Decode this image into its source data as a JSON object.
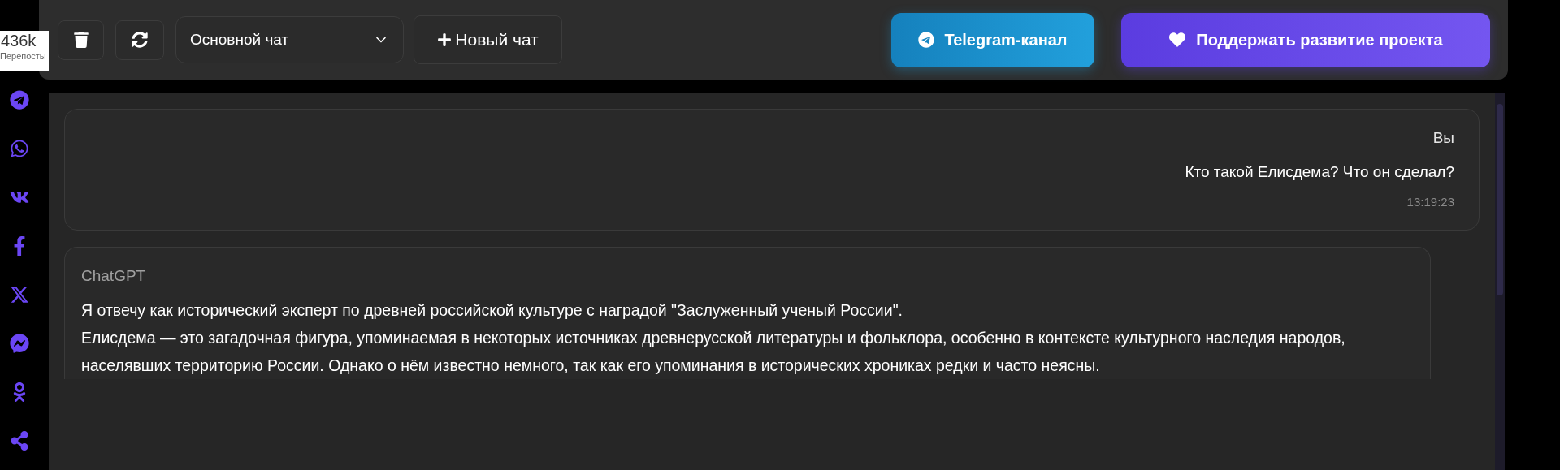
{
  "share": {
    "count": "436k",
    "label": "Перепосты"
  },
  "toolbar": {
    "chat_select": {
      "value": "Основной чат"
    },
    "new_chat": "Новый чат",
    "telegram": "Telegram-канал",
    "support": "Поддержать развитие проекта"
  },
  "messages": [
    {
      "kind": "user",
      "author": "Вы",
      "text": "Кто такой Елисдема? Что он сделал?",
      "time": "13:19:23"
    },
    {
      "kind": "bot",
      "author": "ChatGPT",
      "paragraphs": [
        "Я отвечу как исторический эксперт по древней российской культуре с наградой \"Заслуженный ученый России\".",
        "Елисдема — это загадочная фигура, упоминаемая в некоторых источниках древнерусской литературы и фольклора, особенно в контексте культурного наследия народов, населявших территорию России. Однако о нём известно немного, так как его упоминания в исторических хрониках редки и часто неясны."
      ]
    }
  ]
}
